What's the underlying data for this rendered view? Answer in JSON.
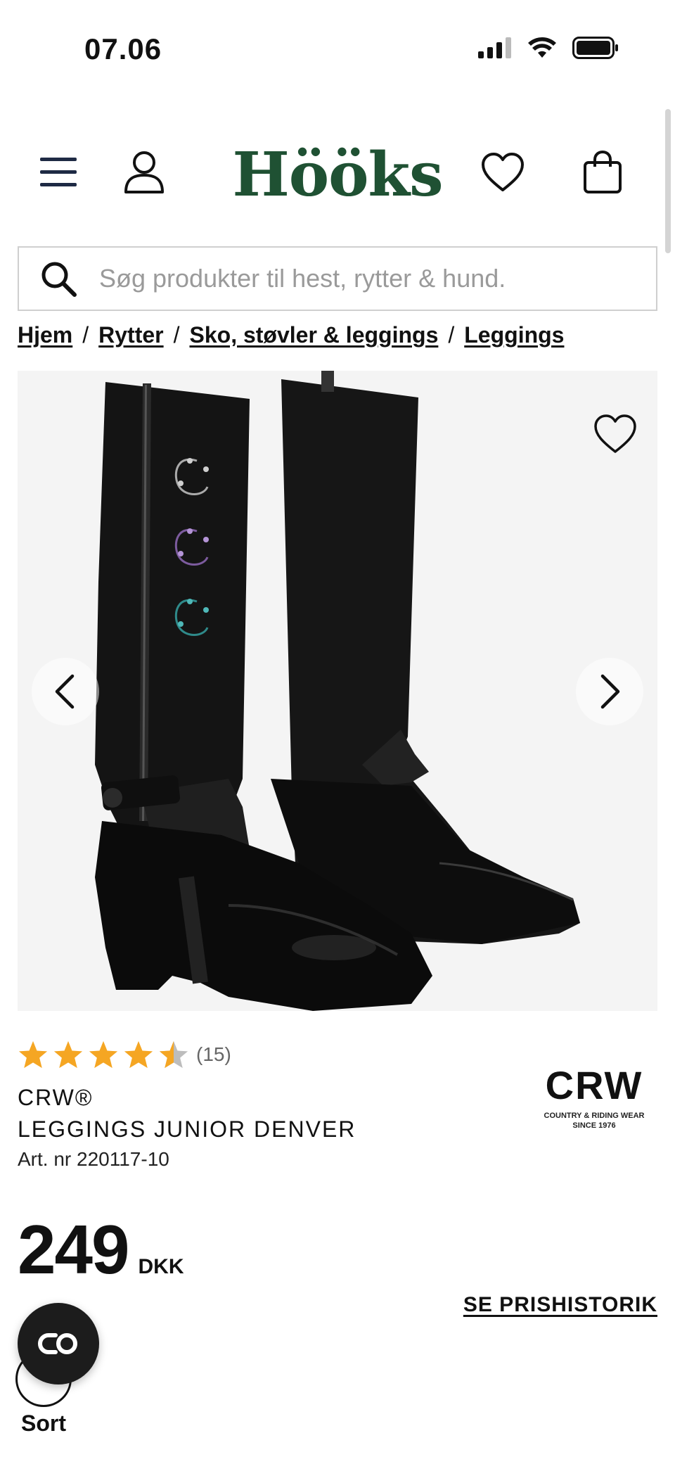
{
  "status_bar": {
    "time": "07.06"
  },
  "header": {
    "logo": "Hööks"
  },
  "search": {
    "placeholder": "Søg produkter til hest, rytter & hund."
  },
  "breadcrumb": [
    "Hjem",
    "Rytter",
    "Sko, støvler & leggings",
    "Leggings"
  ],
  "product": {
    "rating": 4.5,
    "review_count": "(15)",
    "brand": "CRW®",
    "title": "LEGGINGS JUNIOR DENVER",
    "art_nr": "Art. nr 220117-10",
    "price": "249",
    "currency": "DKK",
    "price_history_label": "SE PRISHISTORIK",
    "color_label": "Sort"
  },
  "brand_logo": {
    "text": "CRW",
    "tagline_1": "COUNTRY & RIDING WEAR",
    "tagline_2": "SINCE 1976"
  },
  "colors": {
    "logo_green": "#1f5133",
    "star": "#f5a623",
    "star_empty": "#bdbdbd",
    "image_bg": "#f4f4f4"
  },
  "icons": [
    "menu-icon",
    "user-icon",
    "heart-icon",
    "bag-icon",
    "search-icon",
    "chevron-left-icon",
    "chevron-right-icon",
    "chat-icon"
  ]
}
